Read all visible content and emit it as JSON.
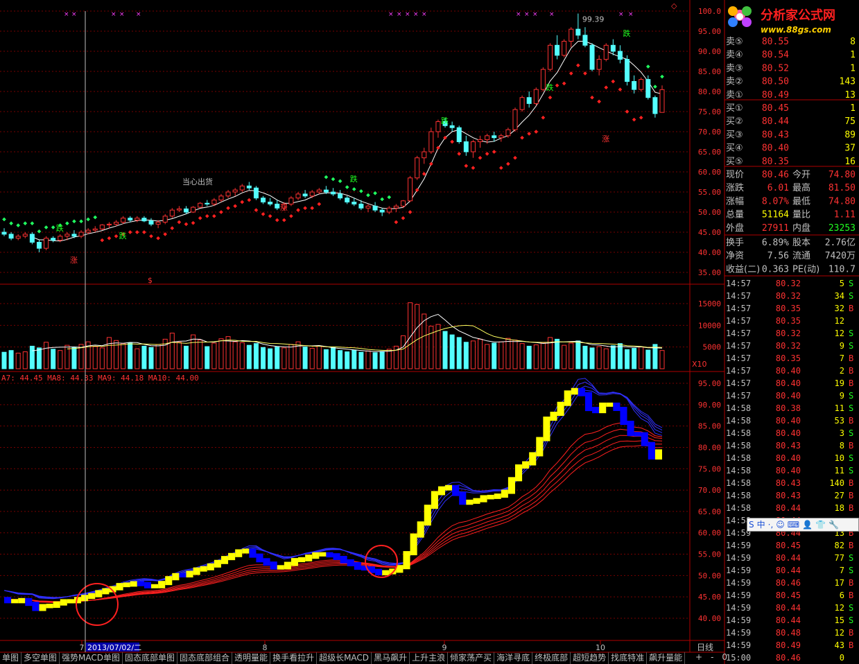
{
  "logo": {
    "name": "分析家公式网",
    "url": "www.88gs.com"
  },
  "colors": {
    "up": "#ff3232",
    "down": "#54ffff",
    "grid": "#7a0000",
    "ma": "#ffffff",
    "sar_up": "#ff2020",
    "sar_down": "#20ff60",
    "ema_fast": "#ffff00",
    "ema_fast_down": "#0000ff",
    "band_blue": "#3030ff",
    "band_red": "#ff2020",
    "axis_text": "#ff3232",
    "tick_time": "#c0c0c0"
  },
  "price_axis": [
    "100.0",
    "95.00",
    "90.00",
    "85.00",
    "80.00",
    "75.00",
    "70.00",
    "65.00",
    "60.00",
    "55.00",
    "50.00",
    "45.00",
    "40.00",
    "35.00"
  ],
  "price_annotation": "99.39",
  "volume_axis": [
    "15000",
    "10000",
    "5000"
  ],
  "volume_unit": "X10",
  "ma_legend": "A7: 44.45  MA8: 44.33  MA9: 44.18  MA10: 44.00",
  "lower_axis": [
    "95.00",
    "90.00",
    "85.00",
    "80.00",
    "75.00",
    "70.00",
    "65.00",
    "60.00",
    "55.00",
    "50.00",
    "45.00",
    "40.00"
  ],
  "date_ticks": [
    "7",
    "8",
    "9",
    "10"
  ],
  "cursor_date": "2013/07/02/二",
  "period": "日线",
  "zoom": [
    "+",
    "-",
    "0"
  ],
  "signals": {
    "zhang": "涨",
    "die": "跌",
    "s": "$",
    "label_top": "当心出货"
  },
  "tabs": [
    "单图",
    "多空单图",
    "强势MACD单图",
    "固态底部单图",
    "固态底部组合",
    "透明量能",
    "换手看拉升",
    "超级长MACD",
    "黑马飙升",
    "上升主浪",
    "倾家荡产买",
    "海洋寻底",
    "终极底部",
    "超短趋势",
    "找底特准",
    "飙升量能"
  ],
  "ime": [
    "S",
    "中",
    "·,",
    "☺",
    "⌨",
    "👤",
    "👕",
    "🔧"
  ],
  "quote": {
    "sell": [
      {
        "label": "卖⑤",
        "price": "80.55",
        "vol": "8"
      },
      {
        "label": "卖④",
        "price": "80.54",
        "vol": "1"
      },
      {
        "label": "卖③",
        "price": "80.52",
        "vol": "1"
      },
      {
        "label": "卖②",
        "price": "80.50",
        "vol": "143"
      },
      {
        "label": "卖①",
        "price": "80.49",
        "vol": "13"
      }
    ],
    "buy": [
      {
        "label": "买①",
        "price": "80.45",
        "vol": "1"
      },
      {
        "label": "买②",
        "price": "80.44",
        "vol": "75"
      },
      {
        "label": "买③",
        "price": "80.43",
        "vol": "89"
      },
      {
        "label": "买④",
        "price": "80.40",
        "vol": "37"
      },
      {
        "label": "买⑤",
        "price": "80.35",
        "vol": "16"
      }
    ],
    "stats": [
      {
        "l1": "现价",
        "v1": "80.46",
        "l2": "今开",
        "v2": "74.80",
        "c1": "#ff3232",
        "c2": "#ff3232"
      },
      {
        "l1": "涨跌",
        "v1": "6.01",
        "l2": "最高",
        "v2": "81.50",
        "c1": "#ff3232",
        "c2": "#ff3232"
      },
      {
        "l1": "涨幅",
        "v1": "8.07%",
        "l2": "最低",
        "v2": "74.80",
        "c1": "#ff3232",
        "c2": "#ff3232"
      },
      {
        "l1": "总量",
        "v1": "51164",
        "l2": "量比",
        "v2": "1.11",
        "c1": "#ffff00",
        "c2": "#ff3232"
      },
      {
        "l1": "外盘",
        "v1": "27911",
        "l2": "内盘",
        "v2": "23253",
        "c1": "#ff3232",
        "c2": "#20ff20"
      }
    ],
    "stats2": [
      {
        "l1": "换手",
        "v1": "6.89%",
        "l2": "股本",
        "v2": "2.76亿"
      },
      {
        "l1": "净资",
        "v1": "7.56",
        "l2": "流通",
        "v2": "7420万"
      },
      {
        "l1": "收益(二)",
        "v1": "0.363",
        "l2": "PE(动)",
        "v2": "110.7"
      }
    ]
  },
  "ticks": [
    {
      "t": "14:57",
      "p": "80.32",
      "v": "5",
      "d": "S"
    },
    {
      "t": "14:57",
      "p": "80.32",
      "v": "34",
      "d": "S"
    },
    {
      "t": "14:57",
      "p": "80.35",
      "v": "32",
      "d": "B"
    },
    {
      "t": "14:57",
      "p": "80.35",
      "v": "12",
      "d": ""
    },
    {
      "t": "14:57",
      "p": "80.32",
      "v": "12",
      "d": "S"
    },
    {
      "t": "14:57",
      "p": "80.32",
      "v": "9",
      "d": "S"
    },
    {
      "t": "14:57",
      "p": "80.35",
      "v": "7",
      "d": "B"
    },
    {
      "t": "14:57",
      "p": "80.40",
      "v": "2",
      "d": "B"
    },
    {
      "t": "14:57",
      "p": "80.40",
      "v": "19",
      "d": "B"
    },
    {
      "t": "14:57",
      "p": "80.40",
      "v": "9",
      "d": "S"
    },
    {
      "t": "14:58",
      "p": "80.38",
      "v": "11",
      "d": "S"
    },
    {
      "t": "14:58",
      "p": "80.40",
      "v": "53",
      "d": "B"
    },
    {
      "t": "14:58",
      "p": "80.40",
      "v": "3",
      "d": "S"
    },
    {
      "t": "14:58",
      "p": "80.43",
      "v": "8",
      "d": "B"
    },
    {
      "t": "14:58",
      "p": "80.40",
      "v": "10",
      "d": "S"
    },
    {
      "t": "14:58",
      "p": "80.40",
      "v": "11",
      "d": "S"
    },
    {
      "t": "14:58",
      "p": "80.43",
      "v": "140",
      "d": "B"
    },
    {
      "t": "14:58",
      "p": "80.43",
      "v": "27",
      "d": "B"
    },
    {
      "t": "14:58",
      "p": "80.44",
      "v": "18",
      "d": "B"
    },
    {
      "t": "14:58",
      "p": "80.44",
      "v": "",
      "d": ""
    },
    {
      "t": "14:59",
      "p": "80.44",
      "v": "13",
      "d": "B"
    },
    {
      "t": "14:59",
      "p": "80.45",
      "v": "82",
      "d": "B"
    },
    {
      "t": "14:59",
      "p": "80.44",
      "v": "77",
      "d": "S"
    },
    {
      "t": "14:59",
      "p": "80.44",
      "v": "7",
      "d": "S"
    },
    {
      "t": "14:59",
      "p": "80.46",
      "v": "17",
      "d": "B"
    },
    {
      "t": "14:59",
      "p": "80.45",
      "v": "6",
      "d": "B"
    },
    {
      "t": "14:59",
      "p": "80.44",
      "v": "12",
      "d": "S"
    },
    {
      "t": "14:59",
      "p": "80.44",
      "v": "15",
      "d": "S"
    },
    {
      "t": "14:59",
      "p": "80.48",
      "v": "12",
      "d": "B"
    },
    {
      "t": "14:59",
      "p": "80.49",
      "v": "43",
      "d": "B"
    },
    {
      "t": "15:00",
      "p": "80.46",
      "v": "0",
      "d": ""
    }
  ],
  "chart_data": {
    "type": "candlestick",
    "price_range": [
      35,
      100
    ],
    "candles": [
      [
        45,
        46,
        44,
        44.5
      ],
      [
        44.5,
        45,
        43,
        43.5
      ],
      [
        43.5,
        44.5,
        43,
        44
      ],
      [
        44,
        45,
        43.5,
        44.5
      ],
      [
        44.5,
        45,
        42,
        42.5
      ],
      [
        42.5,
        43,
        40,
        41
      ],
      [
        41,
        44,
        40.5,
        43.5
      ],
      [
        43.5,
        44,
        42.5,
        43
      ],
      [
        43,
        44.5,
        42.5,
        44
      ],
      [
        44,
        45,
        43,
        44.5
      ],
      [
        44.5,
        45.5,
        43.5,
        44
      ],
      [
        44,
        45.5,
        43.5,
        45
      ],
      [
        45,
        46,
        44.5,
        45.5
      ],
      [
        45.5,
        46.5,
        45,
        45.8
      ],
      [
        45.8,
        47,
        45.5,
        46.8
      ],
      [
        46.8,
        47.5,
        46,
        47
      ],
      [
        47,
        48,
        46.5,
        47.5
      ],
      [
        47.5,
        49,
        47,
        48.5
      ],
      [
        48.5,
        49,
        47.5,
        48
      ],
      [
        48,
        49,
        47.5,
        48.5
      ],
      [
        48.5,
        49,
        47.5,
        47.8
      ],
      [
        47.8,
        48.5,
        46.5,
        47
      ],
      [
        47,
        48,
        46,
        47.5
      ],
      [
        47.5,
        49.5,
        47,
        49
      ],
      [
        49,
        51,
        48.5,
        50.5
      ],
      [
        50.5,
        51.5,
        50,
        50.8
      ],
      [
        50.8,
        51.5,
        49.5,
        50
      ],
      [
        50,
        51.5,
        49.8,
        51.2
      ],
      [
        51.2,
        52.5,
        51,
        52.2
      ],
      [
        52.2,
        53,
        51.5,
        52
      ],
      [
        52,
        53.5,
        51.5,
        53
      ],
      [
        53,
        54.5,
        52.5,
        54
      ],
      [
        54,
        55.5,
        53.5,
        55
      ],
      [
        55,
        56,
        54,
        55.5
      ],
      [
        55.5,
        57,
        55,
        56.5
      ],
      [
        56.5,
        57.5,
        55.5,
        56
      ],
      [
        56,
        56.5,
        53,
        53.5
      ],
      [
        53.5,
        54,
        52,
        52.5
      ],
      [
        52.5,
        53.5,
        51.5,
        52
      ],
      [
        52,
        53,
        50.5,
        51
      ],
      [
        51,
        52.5,
        50.5,
        52
      ],
      [
        52,
        54,
        51.5,
        53.5
      ],
      [
        53.5,
        55,
        53,
        54.5
      ],
      [
        54.5,
        55.5,
        53.5,
        54
      ],
      [
        54,
        55.5,
        53.5,
        55
      ],
      [
        55,
        56,
        54.5,
        55.5
      ],
      [
        55.5,
        56.5,
        54.5,
        55
      ],
      [
        55,
        56,
        54,
        54.5
      ],
      [
        54.5,
        55.5,
        53,
        53.5
      ],
      [
        53.5,
        54,
        52,
        52.5
      ],
      [
        52.5,
        53.5,
        51.5,
        52
      ],
      [
        52,
        53,
        50.5,
        51
      ],
      [
        51,
        52,
        50,
        51.5
      ],
      [
        51.5,
        52.5,
        50,
        50.5
      ],
      [
        50.5,
        51,
        49,
        50
      ],
      [
        50,
        51.5,
        49.5,
        51
      ],
      [
        51,
        52,
        50,
        51.5
      ],
      [
        51.5,
        53,
        51,
        52.8
      ],
      [
        52.8,
        59,
        52.5,
        58.5
      ],
      [
        58.5,
        64,
        58,
        63.5
      ],
      [
        63.5,
        66,
        62,
        65
      ],
      [
        65,
        71,
        64.5,
        70
      ],
      [
        70,
        73,
        68.5,
        72.5
      ],
      [
        72.5,
        73.5,
        71,
        71.5
      ],
      [
        71.5,
        72.5,
        70,
        71
      ],
      [
        71,
        71.5,
        67,
        67.5
      ],
      [
        67.5,
        69,
        64,
        65
      ],
      [
        65,
        68,
        63.5,
        67.5
      ],
      [
        67.5,
        69,
        66,
        68
      ],
      [
        68,
        69.5,
        67,
        69
      ],
      [
        69,
        70,
        67.5,
        68.5
      ],
      [
        68.5,
        69.5,
        67.5,
        69
      ],
      [
        69,
        71,
        68.5,
        70.5
      ],
      [
        70.5,
        76,
        70,
        75.5
      ],
      [
        75.5,
        79,
        75,
        78.5
      ],
      [
        78.5,
        80,
        76,
        77
      ],
      [
        77,
        81,
        76.5,
        80.5
      ],
      [
        80.5,
        86,
        80,
        85.5
      ],
      [
        85.5,
        92,
        85,
        91.5
      ],
      [
        91.5,
        94,
        88,
        89
      ],
      [
        89,
        93,
        88.5,
        92.5
      ],
      [
        92.5,
        96,
        91,
        95.5
      ],
      [
        95.5,
        99.39,
        93,
        94
      ],
      [
        94,
        96,
        91,
        91.5
      ],
      [
        91.5,
        92,
        85,
        85.5
      ],
      [
        85.5,
        89,
        84,
        88
      ],
      [
        88,
        92,
        87.5,
        91.5
      ],
      [
        91.5,
        93,
        89,
        90
      ],
      [
        90,
        91.5,
        87,
        88
      ],
      [
        88,
        89,
        81.5,
        82.5
      ],
      [
        82.5,
        84,
        79.5,
        80.5
      ],
      [
        80.5,
        83.5,
        80,
        83
      ],
      [
        83,
        84,
        78,
        78.5
      ],
      [
        78.5,
        79,
        73.5,
        74.5
      ],
      [
        74.8,
        81.5,
        74.8,
        80.46
      ]
    ],
    "volume": [
      3800,
      4200,
      3600,
      3900,
      5200,
      4800,
      6100,
      4500,
      4200,
      5400,
      4900,
      5600,
      6200,
      5100,
      4800,
      7200,
      6500,
      5800,
      6000,
      4600,
      5200,
      4900,
      5600,
      6800,
      8200,
      6100,
      5200,
      7800,
      6600,
      5100,
      5900,
      6900,
      7400,
      6200,
      6000,
      5400,
      5800,
      4900,
      4600,
      5000,
      4800,
      5600,
      6200,
      5000,
      4700,
      5200,
      4400,
      4900,
      4200,
      3900,
      4300,
      3800,
      4100,
      3700,
      4000,
      4500,
      5200,
      7600,
      15200,
      14800,
      12600,
      9800,
      10200,
      8600,
      7800,
      7200,
      6100,
      6400,
      6800,
      5600,
      5900,
      6200,
      7000,
      6600,
      5800,
      5200,
      5500,
      6000,
      7200,
      6800,
      5400,
      5900,
      6400,
      5200,
      4800,
      5100,
      4600,
      5300,
      5800,
      4400,
      4700,
      5000,
      4300,
      5600,
      4200,
      5100
    ],
    "title": "",
    "xlabel": "",
    "ylabel": ""
  }
}
